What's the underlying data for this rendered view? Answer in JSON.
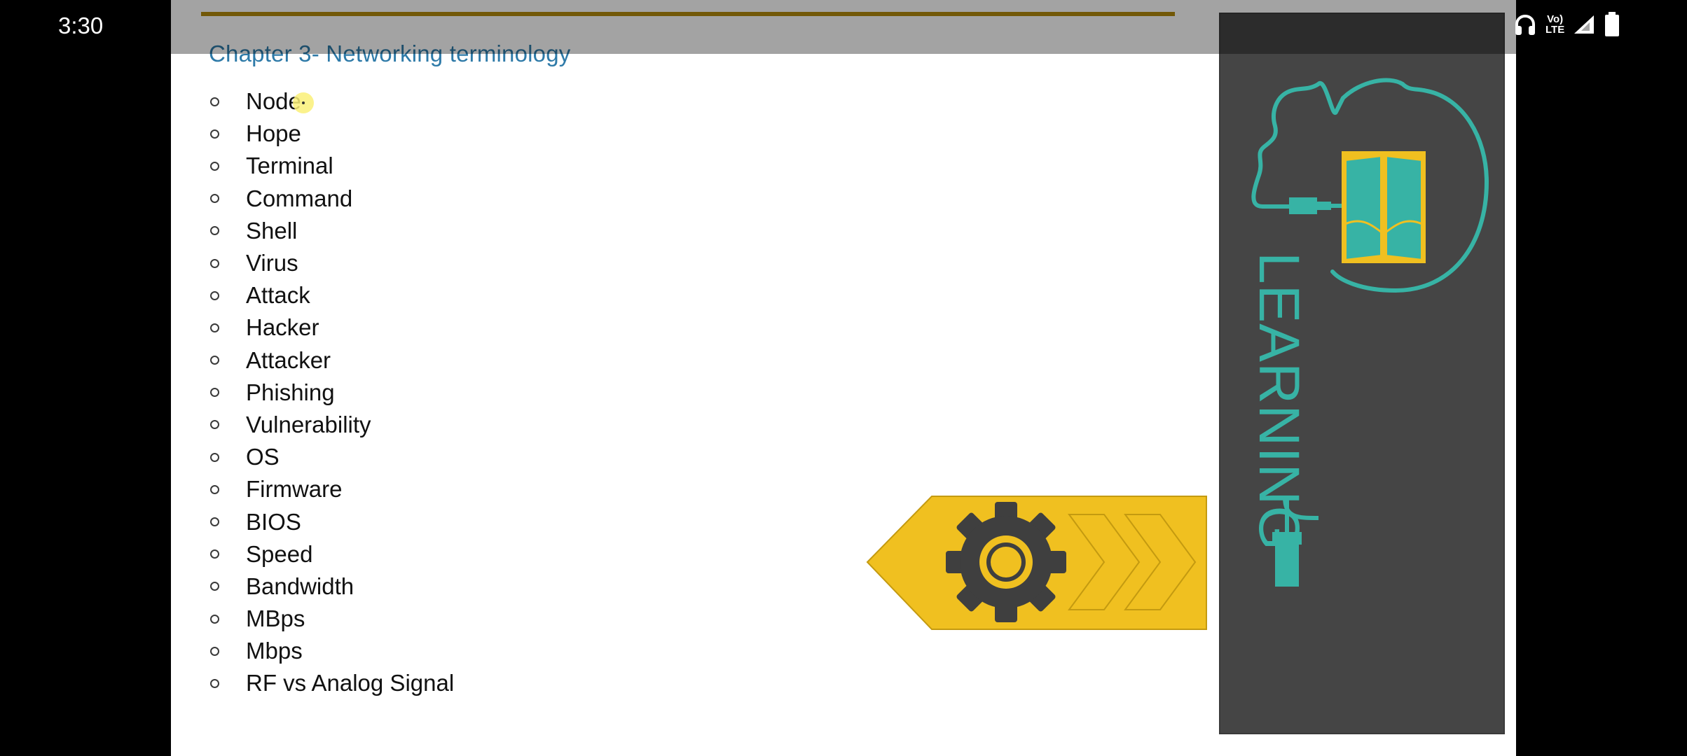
{
  "status_bar": {
    "time": "3:30",
    "lte_top": "Vo)",
    "lte_bottom": "LTE",
    "icons": [
      "headphones-icon",
      "volte-lte-icon",
      "signal-icon",
      "battery-icon"
    ]
  },
  "slide": {
    "title": "Chapter 3- Networking terminology",
    "terms": [
      "Node",
      "Hope",
      "Terminal",
      "Command",
      "Shell",
      "Virus",
      "Attack",
      "Hacker",
      "Attacker",
      "Phishing",
      "Vulnerability",
      "OS",
      "Firmware",
      "BIOS",
      "Speed",
      "Bandwidth",
      "MBps",
      "Mbps",
      "RF vs Analog Signal"
    ],
    "learning_word": "LEARNING"
  },
  "colors": {
    "title": "#2e7aa8",
    "rule": "#b38a0b",
    "panel": "#454545",
    "teal": "#37b3a5",
    "yellow": "#f0c020"
  }
}
